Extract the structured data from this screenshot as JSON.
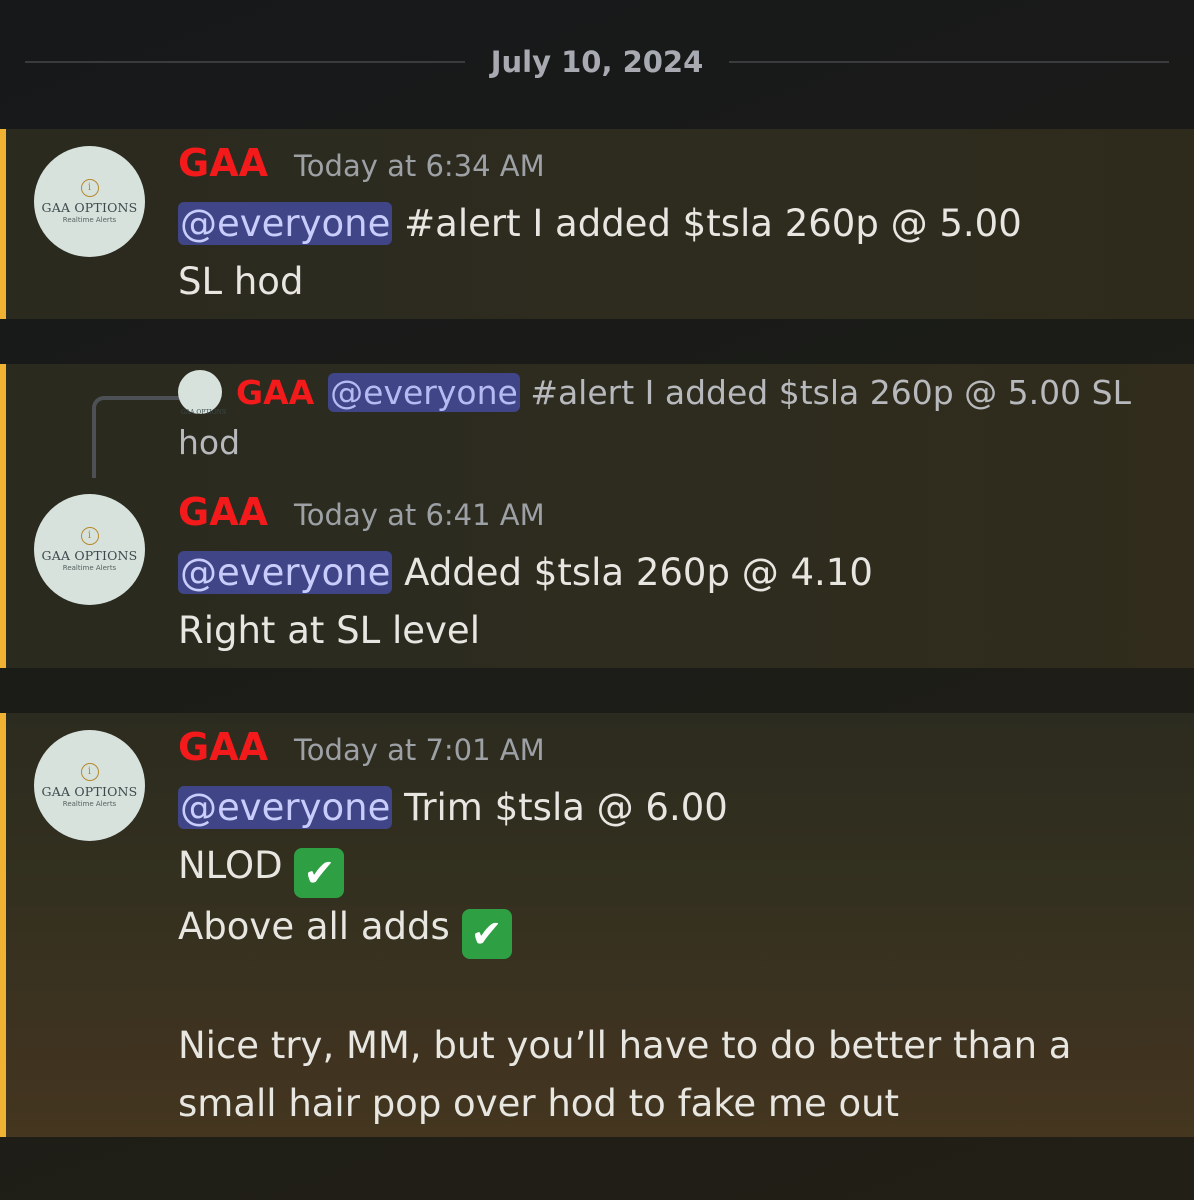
{
  "date_divider": "July 10, 2024",
  "avatar": {
    "brand": "GAA OPTIONS",
    "tagline": "Realtime Alerts"
  },
  "messages": [
    {
      "username": "GAA",
      "timestamp": "Today at 6:34 AM",
      "mention": "@everyone",
      "line1": "#alert I added $tsla 260p @ 5.00",
      "line2": "SL hod"
    },
    {
      "reply": {
        "username": "GAA",
        "mention": "@everyone",
        "text": "#alert I added $tsla 260p @ 5.00 SL hod"
      },
      "username": "GAA",
      "timestamp": "Today at 6:41 AM",
      "mention": "@everyone",
      "line1": "Added $tsla 260p @ 4.10",
      "line2": "Right at SL level"
    },
    {
      "username": "GAA",
      "timestamp": "Today at 7:01 AM",
      "mention": "@everyone",
      "line1": "Trim $tsla @ 6.00",
      "line2": "NLOD",
      "line3": "Above all adds",
      "check": "✔",
      "line4": "Nice try, MM, but you’ll have to do better than a",
      "line5": "small hair pop over hod to fake me out"
    }
  ],
  "colors": {
    "username": "#f21a1a",
    "mention_bg": "#3f4587",
    "highlight_bar": "#f0b232",
    "check_bg": "#2ea043"
  }
}
